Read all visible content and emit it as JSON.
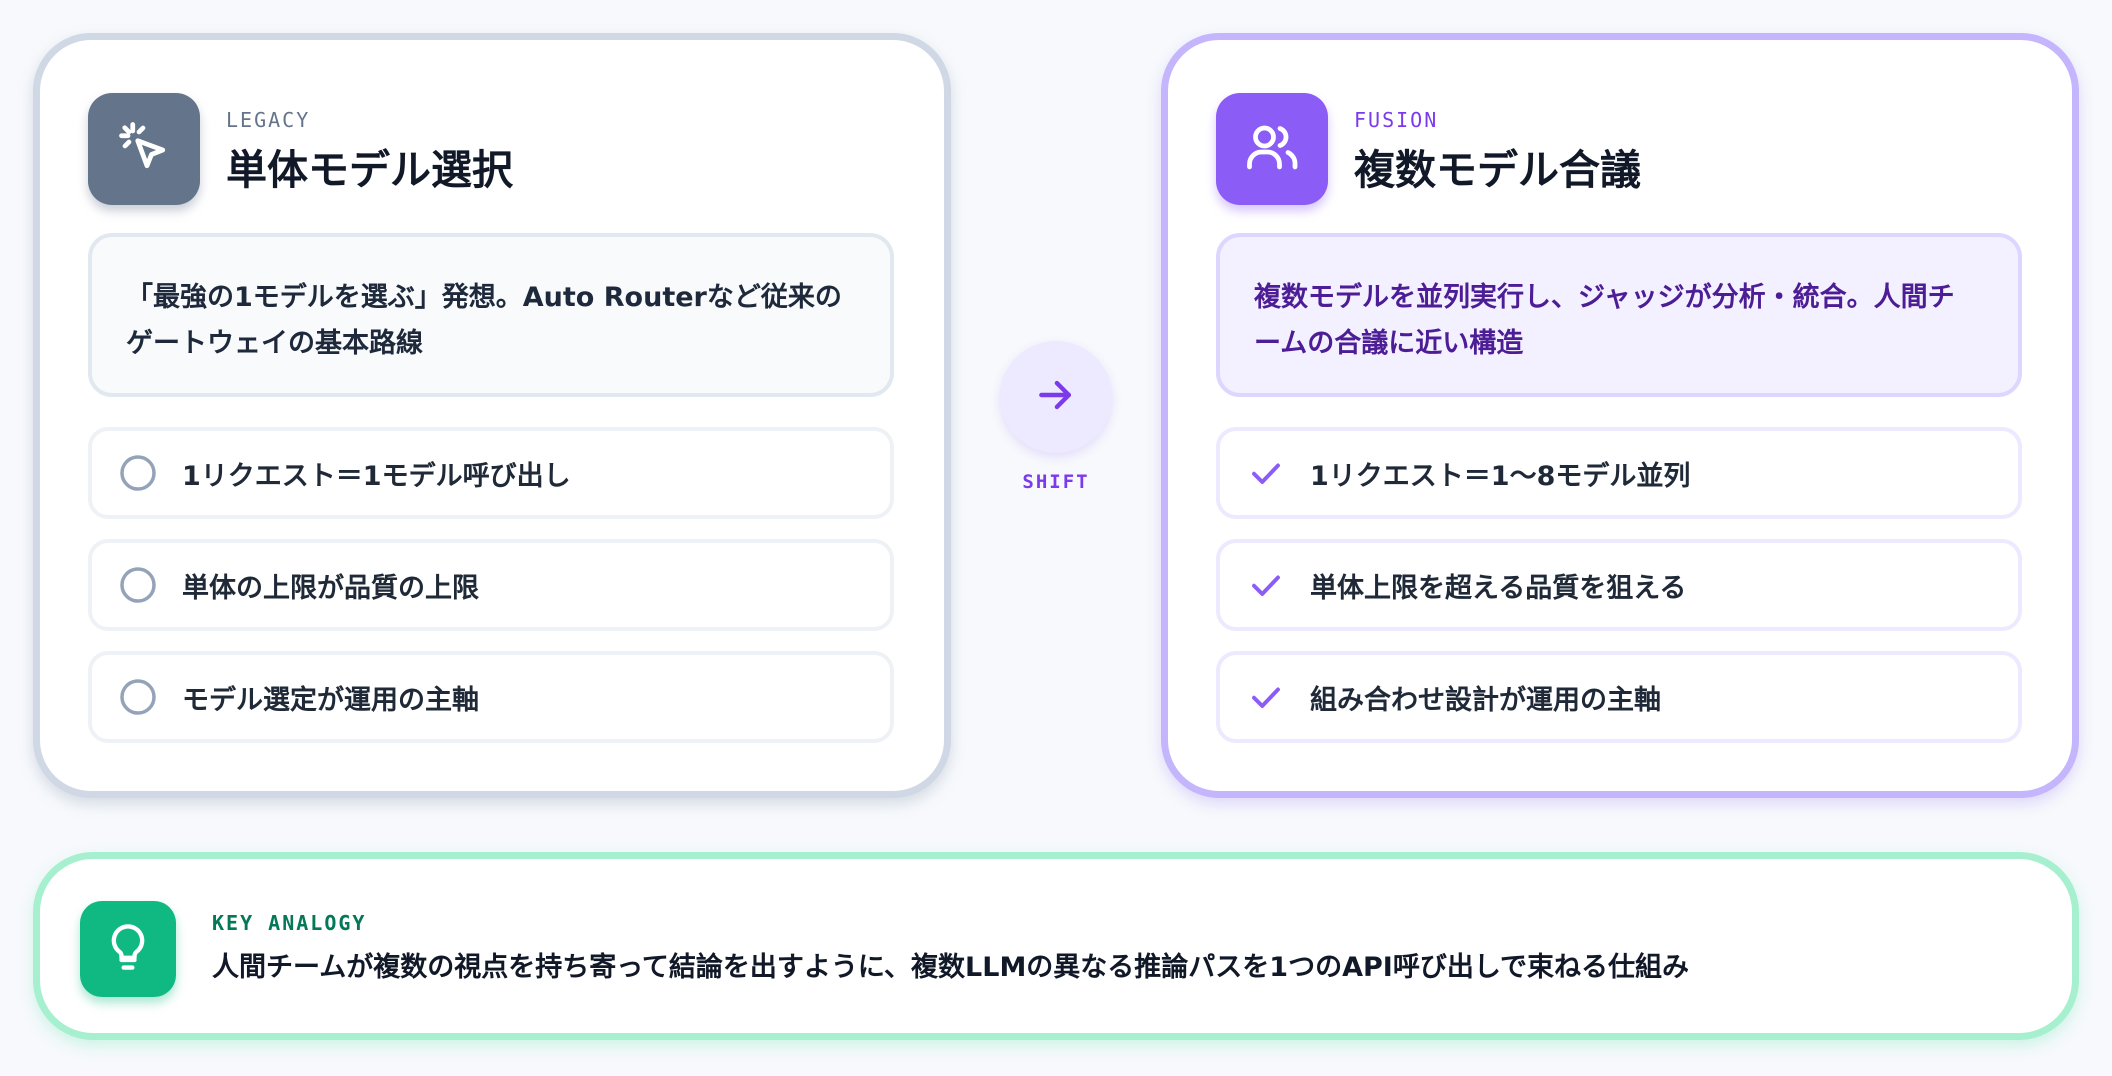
{
  "legacy": {
    "eyebrow": "LEGACY",
    "title": "単体モデル選択",
    "description_line1": "「最強の1モデルを選ぶ」発想。Auto Routerなど従来の",
    "description_line2": "ゲートウェイの基本路線",
    "items": [
      {
        "label": "1リクエスト＝1モデル呼び出し"
      },
      {
        "label": "単体の上限が品質の上限"
      },
      {
        "label": "モデル選定が運用の主軸"
      }
    ],
    "badge_icon": "cursor-click-icon",
    "item_icon": "empty-circle-icon",
    "accent_color": "#64748b"
  },
  "transition": {
    "label": "SHIFT",
    "icon": "arrow-right-icon"
  },
  "fusion": {
    "eyebrow": "FUSION",
    "title": "複数モデル合議",
    "description_line1": "複数モデルを並列実行し、ジャッジが分析・統合。人間チ",
    "description_line2": "ームの合議に近い構造",
    "items": [
      {
        "label": "1リクエスト＝1〜8モデル並列"
      },
      {
        "label": "単体上限を超える品質を狙える"
      },
      {
        "label": "組み合わせ設計が運用の主軸"
      }
    ],
    "badge_icon": "users-icon",
    "item_icon": "check-icon",
    "accent_color": "#8b5cf6"
  },
  "analogy": {
    "eyebrow": "KEY ANALOGY",
    "text": "人間チームが複数の視点を持ち寄って結論を出すように、複数LLMの異なる推論パスを1つのAPI呼び出しで束ねる仕組み",
    "icon": "lightbulb-icon",
    "accent_color": "#10b981"
  }
}
